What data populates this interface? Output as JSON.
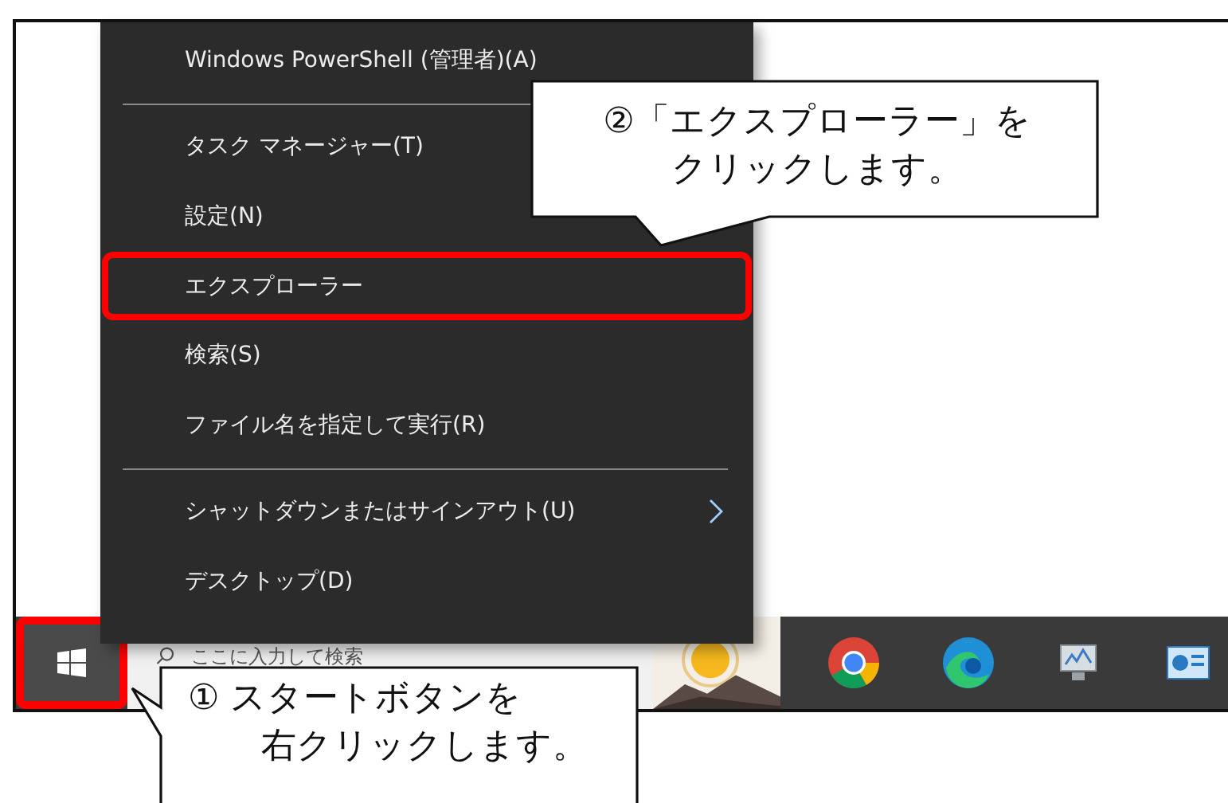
{
  "context_menu": {
    "items": [
      {
        "kind": "item",
        "label": "Windows PowerShell (管理者)(A)",
        "selected": false
      },
      {
        "kind": "separator"
      },
      {
        "kind": "item",
        "label": "タスク マネージャー(T)",
        "selected": false
      },
      {
        "kind": "item",
        "label": "設定(N)",
        "selected": false
      },
      {
        "kind": "item",
        "label": "エクスプローラー",
        "selected": true
      },
      {
        "kind": "item",
        "label": "検索(S)",
        "selected": false
      },
      {
        "kind": "item",
        "label": "ファイル名を指定して実行(R)",
        "selected": false
      },
      {
        "kind": "separator"
      },
      {
        "kind": "submenu",
        "label": "シャットダウンまたはサインアウト(U)",
        "selected": false
      },
      {
        "kind": "item",
        "label": "デスクトップ(D)",
        "selected": false
      }
    ]
  },
  "taskbar": {
    "start_button": {
      "selected": true
    },
    "search": {
      "placeholder": "ここに入力して検索"
    }
  },
  "callouts": [
    {
      "kind": "menu",
      "lines": [
        "②「エクスプローラー」を",
        "クリックします。"
      ]
    },
    {
      "kind": "start",
      "lines": [
        "① スタートボタンを",
        "右クリックします。"
      ]
    }
  ]
}
